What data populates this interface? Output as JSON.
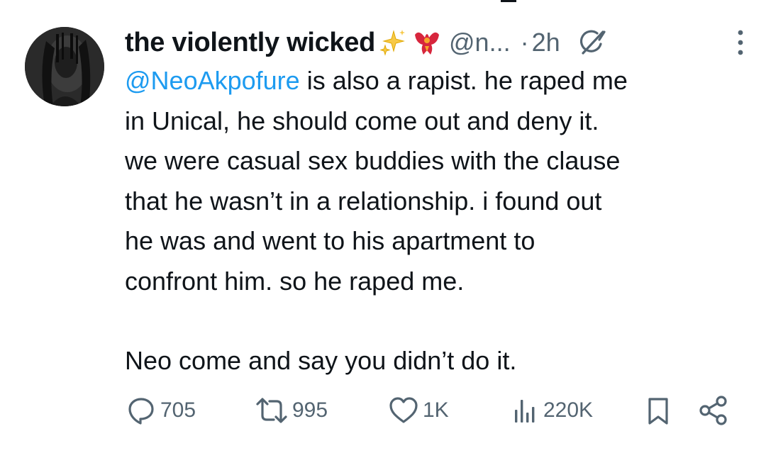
{
  "tweet": {
    "display_name": "the violently wicked",
    "emoji_badges": [
      "sparkles-icon",
      "red-bird-icon"
    ],
    "handle": "@n...",
    "dot": "·",
    "timestamp": "2h",
    "mention": "@NeoAkpofure",
    "lines": [
      " is also a rapist. he raped me",
      "in Unical, he should come out and deny it.",
      "we were casual sex buddies with the clause",
      "that he wasn’t in a relationship. i found out",
      "he was and went to his apartment to",
      "confront him. so he raped me."
    ],
    "closing_line": "Neo come and say you didn’t do it."
  },
  "actions": {
    "replies": "705",
    "reposts": "995",
    "likes": "1K",
    "views": "220K"
  },
  "colors": {
    "text": "#0f1419",
    "secondary": "#536471",
    "link": "#1d9bf0",
    "background": "#ffffff"
  }
}
